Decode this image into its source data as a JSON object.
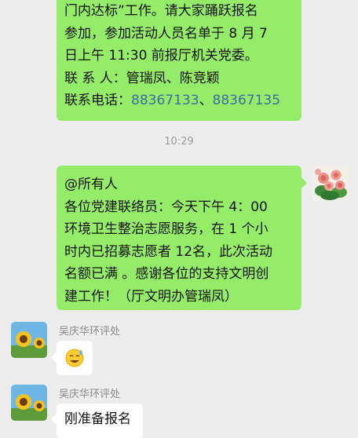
{
  "messages": {
    "m1": {
      "lines": [
        "门内达标”工作。请大家踊跃报名",
        "参加，参加活动人员名单于 8 月 7",
        "日上午 11:30 前报厅机关党委。",
        "联 系 人：管瑞凤、陈竞颖"
      ],
      "phone_label": "联系电话：",
      "phone1": "88367133",
      "phone_sep": "、",
      "phone2": "88367135"
    },
    "timestamp": "10:29",
    "m2": {
      "lines": [
        "@所有人",
        "各位党建联络员：今天下午 4：00",
        "环境卫生整治志愿服务，在 1 个小",
        "时内已招募志愿者 12名，此次活动",
        "名额已满 。感谢各位的支持文明创",
        "建工作！（厅文明办管瑞凤）"
      ]
    },
    "m3": {
      "sender": "吴庆华环评处",
      "emoji_icon": "sweat-smile-emoji"
    },
    "m4": {
      "sender": "吴庆华环评处",
      "text": "刚准备报名"
    }
  },
  "colors": {
    "background": "#ededed",
    "my_bubble": "#95ec69",
    "other_bubble": "#ffffff",
    "link": "#3b6ea5"
  }
}
